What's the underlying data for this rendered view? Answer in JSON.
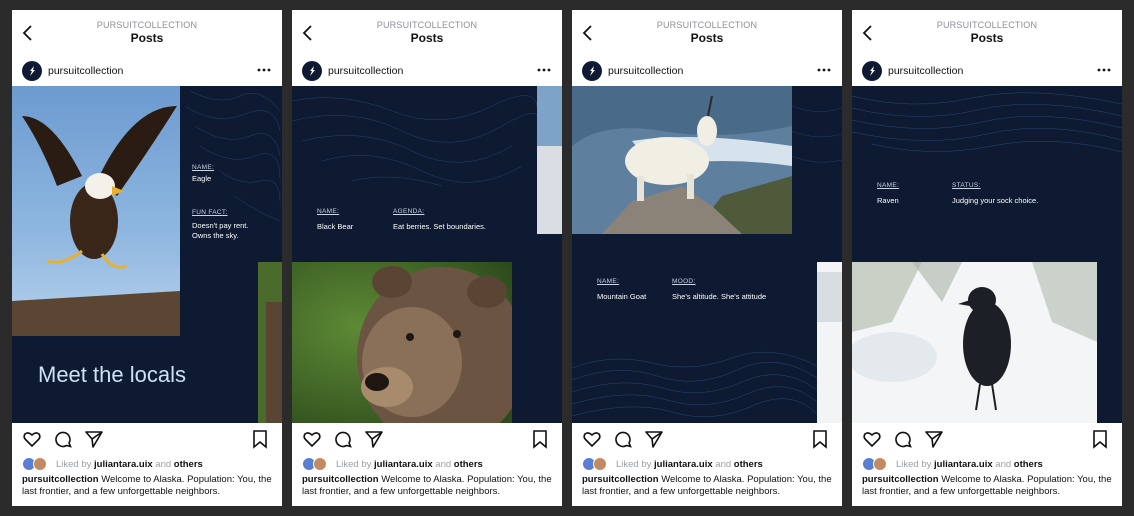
{
  "common": {
    "account": "PURSUITCOLLECTION",
    "page_title": "Posts",
    "username": "pursuitcollection",
    "liked_prefix": "Liked by",
    "liked_user": "juliantara.uix",
    "liked_and": "and",
    "liked_others": "others",
    "caption_user": "pursuitcollection",
    "caption_text": "Welcome to Alaska. Population: You, the last frontier, and a few unforgettable neighbors."
  },
  "posts": [
    {
      "label1": "NAME:",
      "value1": "Eagle",
      "label2": "FUN FACT:",
      "value2": "Doesn't pay rent.\nOwns the sky.",
      "headline": "Meet the locals"
    },
    {
      "label1": "NAME:",
      "value1": "Black Bear",
      "label2": "AGENDA:",
      "value2": "Eat berries. Set boundaries."
    },
    {
      "label1": "NAME:",
      "value1": "Mountain Goat",
      "label2": "MOOD:",
      "value2": "She's altitude. She's attitude"
    },
    {
      "label1": "NAME:",
      "value1": "Raven",
      "label2": "STATUS:",
      "value2": "Judging your sock choice."
    }
  ],
  "icons": [
    "chevron-left-icon",
    "more-horizontal-icon",
    "heart-icon",
    "comment-icon",
    "send-icon",
    "bookmark-icon"
  ],
  "colors": {
    "post_bg": "#0e1a31",
    "topo_line": "#3a5a8a",
    "headline": "#cfe0f1"
  }
}
